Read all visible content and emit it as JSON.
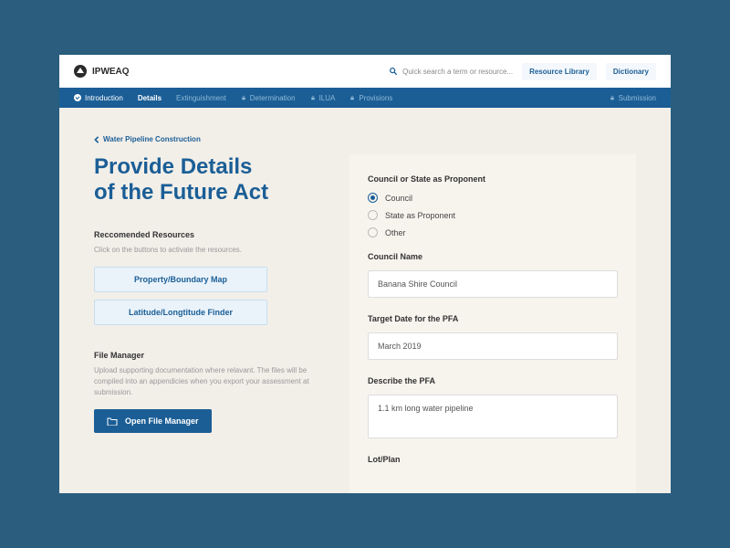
{
  "brand": "IPWEAQ",
  "topbar": {
    "search_placeholder": "Quick search a term or resource...",
    "resource_library": "Resource Library",
    "dictionary": "Dictionary"
  },
  "tabs": {
    "introduction": "Introduction",
    "details": "Details",
    "extinguishment": "Extinguishment",
    "determination": "Determination",
    "ilua": "ILUA",
    "provisions": "Provisions",
    "submission": "Submission"
  },
  "breadcrumb": "Water Pipeline Construction",
  "title_l1": "Provide Details",
  "title_l2": "of the Future Act",
  "resources": {
    "heading": "Reccomended Resources",
    "subtext": "Click on the buttons to activate the resources.",
    "btn1": "Property/Boundary Map",
    "btn2": "Latitude/Longtitude Finder"
  },
  "file_manager": {
    "heading": "File Manager",
    "subtext": "Upload supporting documentation where relavant. The files will be compiled into an appendicies when you export your assessment at submission.",
    "button": "Open File Manager"
  },
  "form": {
    "proponent_label": "Council or State as Proponent",
    "radios": {
      "council": "Council",
      "state": "State as Proponent",
      "other": "Other"
    },
    "council_name_label": "Council Name",
    "council_name_value": "Banana Shire Council",
    "target_date_label": "Target Date for the PFA",
    "target_date_value": "March 2019",
    "describe_label": "Describe the PFA",
    "describe_value": "1.1 km long water pipeline",
    "lotplan_label": "Lot/Plan"
  }
}
